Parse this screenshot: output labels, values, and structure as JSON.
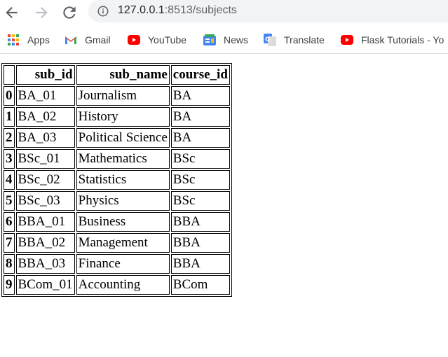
{
  "browser": {
    "url_host": "127.0.0.1",
    "url_rest": ":8513/subjects",
    "bookmarks": [
      {
        "label": "Apps",
        "icon": "apps-grid-icon"
      },
      {
        "label": "Gmail",
        "icon": "gmail-icon"
      },
      {
        "label": "YouTube",
        "icon": "youtube-icon"
      },
      {
        "label": "News",
        "icon": "news-icon"
      },
      {
        "label": "Translate",
        "icon": "translate-icon"
      },
      {
        "label": "Flask Tutorials - Yo",
        "icon": "youtube-icon"
      }
    ]
  },
  "table": {
    "columns": [
      "",
      "sub_id",
      "sub_name",
      "course_id"
    ],
    "rows": [
      {
        "index": "0",
        "sub_id": "BA_01",
        "sub_name": "Journalism",
        "course_id": "BA"
      },
      {
        "index": "1",
        "sub_id": "BA_02",
        "sub_name": "History",
        "course_id": "BA"
      },
      {
        "index": "2",
        "sub_id": "BA_03",
        "sub_name": "Political Science",
        "course_id": "BA"
      },
      {
        "index": "3",
        "sub_id": "BSc_01",
        "sub_name": "Mathematics",
        "course_id": "BSc"
      },
      {
        "index": "4",
        "sub_id": "BSc_02",
        "sub_name": "Statistics",
        "course_id": "BSc"
      },
      {
        "index": "5",
        "sub_id": "BSc_03",
        "sub_name": "Physics",
        "course_id": "BSc"
      },
      {
        "index": "6",
        "sub_id": "BBA_01",
        "sub_name": "Business",
        "course_id": "BBA"
      },
      {
        "index": "7",
        "sub_id": "BBA_02",
        "sub_name": "Management",
        "course_id": "BBA"
      },
      {
        "index": "8",
        "sub_id": "BBA_03",
        "sub_name": "Finance",
        "course_id": "BBA"
      },
      {
        "index": "9",
        "sub_id": "BCom_01",
        "sub_name": "Accounting",
        "course_id": "BCom"
      }
    ]
  }
}
